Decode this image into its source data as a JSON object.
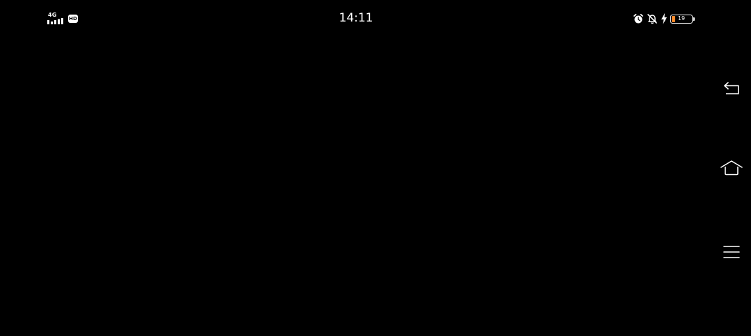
{
  "status_bar": {
    "network_type": "4G",
    "hd_badge": "HD",
    "time": "14:11",
    "battery_level": "19",
    "battery_percent": 19,
    "battery_accent_color": "#ff8a2a",
    "icons": [
      "signal-icon",
      "alarm-icon",
      "bell-off-icon",
      "charging-icon",
      "battery-icon"
    ]
  },
  "navigation": {
    "buttons": [
      {
        "name": "back",
        "icon": "back-arrow-icon"
      },
      {
        "name": "home",
        "icon": "home-icon"
      },
      {
        "name": "menu",
        "icon": "menu-icon"
      }
    ]
  },
  "theme": {
    "background": "#000000",
    "foreground": "#ffffff"
  }
}
